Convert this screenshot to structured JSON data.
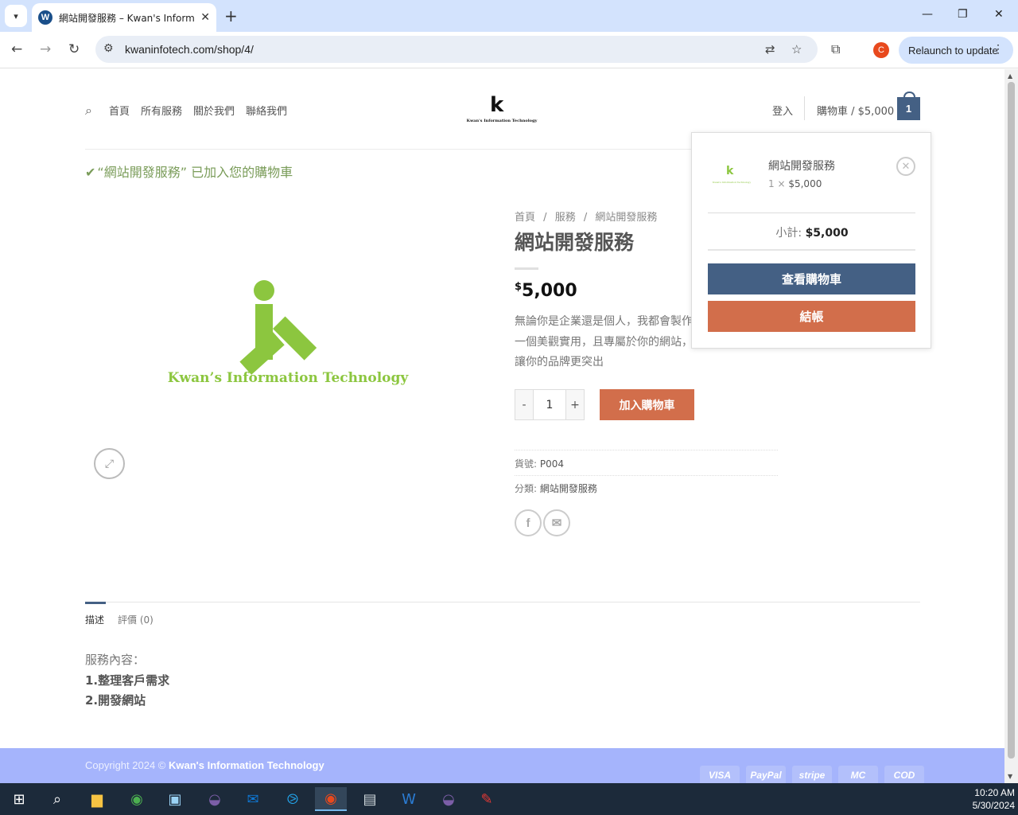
{
  "browser": {
    "tab_title": "網站開發服務 – Kwan's Informa",
    "url": "kwaninfotech.com/shop/4/",
    "relaunch_label": "Relaunch to update",
    "profile_initial": "C"
  },
  "header": {
    "nav": [
      "首頁",
      "所有服務",
      "關於我們",
      "聯絡我們"
    ],
    "logo_letter": "k",
    "logo_subtitle": "Kwan's Information Technology",
    "login": "登入",
    "cart_label": "購物車 / $5,000",
    "cart_count": "1"
  },
  "notice": "“網站開發服務” 已加入您的購物車",
  "product": {
    "image_text": "Kwan’s Information Technology",
    "breadcrumb": [
      "首頁",
      "/",
      "服務",
      "/",
      "網站開發服務"
    ],
    "title": "網站開發服務",
    "currency": "$",
    "price": "5,000",
    "description": "無論你是企業還是個人，我都會製作一個美觀實用，且專屬於你的網站，讓你的品牌更突出",
    "qty_minus": "-",
    "qty_value": "1",
    "qty_plus": "+",
    "add_to_cart": "加入購物車",
    "sku_label": "貨號:",
    "sku": "P004",
    "category_label": "分類:",
    "category": "網站開發服務"
  },
  "minicart": {
    "item_name": "網站開發服務",
    "item_qty": "1 ×",
    "item_price": "$5,000",
    "subtotal_label": "小計:",
    "subtotal": "$5,000",
    "view_cart": "查看購物車",
    "checkout": "結帳",
    "view_cart_color": "#446084",
    "checkout_color": "#d26e4b"
  },
  "tabs": {
    "description": "描述",
    "reviews": "評價 (0)"
  },
  "desc_body": {
    "heading": "服務內容：",
    "item1": "1.整理客戶需求",
    "item2": "2.開發網站"
  },
  "footer": {
    "copyright_prefix": "Copyright 2024 ©",
    "company": "Kwan's Information Technology",
    "payments": [
      "VISA",
      "PayPal",
      "stripe",
      "MC",
      "COD"
    ]
  },
  "taskbar": {
    "time": "10:20 AM",
    "date": "5/30/2024"
  }
}
